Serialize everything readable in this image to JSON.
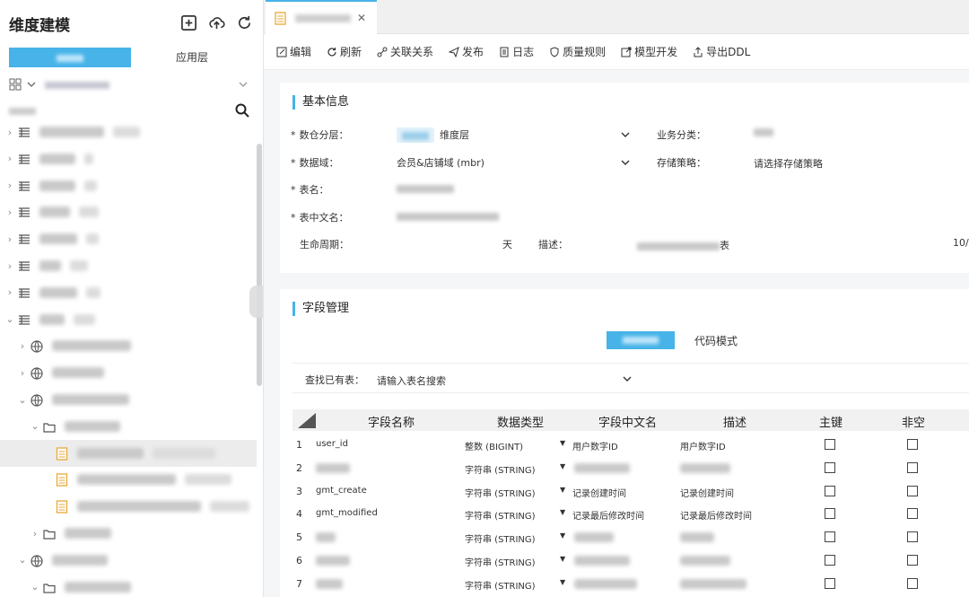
{
  "sidebar": {
    "title": "维度建模",
    "tabs": [
      "",
      "应用层"
    ],
    "category_placeholder": "",
    "search_placeholder": "",
    "icons": {
      "add": "add-square-icon",
      "publish": "upload-cloud-icon",
      "refresh": "refresh-icon"
    }
  },
  "toolbar": {
    "edit": "编辑",
    "refresh": "刷新",
    "relations": "关联关系",
    "publish": "发布",
    "log": "日志",
    "quality": "质量规则",
    "dev": "模型开发",
    "export": "导出DDL"
  },
  "basic": {
    "title": "基本信息",
    "layer_label": "数仓分层：",
    "layer_value": "维度层",
    "category_label": "业务分类：",
    "domain_label": "数据域：",
    "domain_value": "会员&店铺域 (mbr)",
    "storage_label": "存储策略：",
    "storage_value": "请选择存储策略",
    "table_name_label": "表名：",
    "table_cn_label": "表中文名：",
    "lifecycle_label": "生命周期：",
    "lifecycle_unit": "天",
    "desc_label": "描述：",
    "desc_suffix": "表",
    "desc_count": "10/"
  },
  "fields": {
    "title": "字段管理",
    "mode_visual": "",
    "mode_code": "代码模式",
    "find_label": "查找已有表：",
    "find_placeholder": "请输入表名搜索",
    "columns": [
      "字段名称",
      "数据类型",
      "字段中文名",
      "描述",
      "主键",
      "非空"
    ],
    "rows": [
      {
        "no": "1",
        "name": "user_id",
        "type": "整数 (BIGINT)",
        "cn": "用户数字ID",
        "desc": "用户数字ID"
      },
      {
        "no": "2",
        "name": "",
        "type": "字符串 (STRING)",
        "cn": "",
        "desc": ""
      },
      {
        "no": "3",
        "name": "gmt_create",
        "type": "字符串 (STRING)",
        "cn": "记录创建时间",
        "desc": "记录创建时间"
      },
      {
        "no": "4",
        "name": "gmt_modified",
        "type": "字符串 (STRING)",
        "cn": "记录最后修改时间",
        "desc": "记录最后修改时间"
      },
      {
        "no": "5",
        "name": "",
        "type": "字符串 (STRING)",
        "cn": "",
        "desc": ""
      },
      {
        "no": "6",
        "name": "",
        "type": "字符串 (STRING)",
        "cn": "",
        "desc": ""
      },
      {
        "no": "7",
        "name": "",
        "type": "字符串 (STRING)",
        "cn": "",
        "desc": ""
      }
    ]
  },
  "colors": {
    "accent": "#47b3e8",
    "selected_row": "#ececec"
  }
}
